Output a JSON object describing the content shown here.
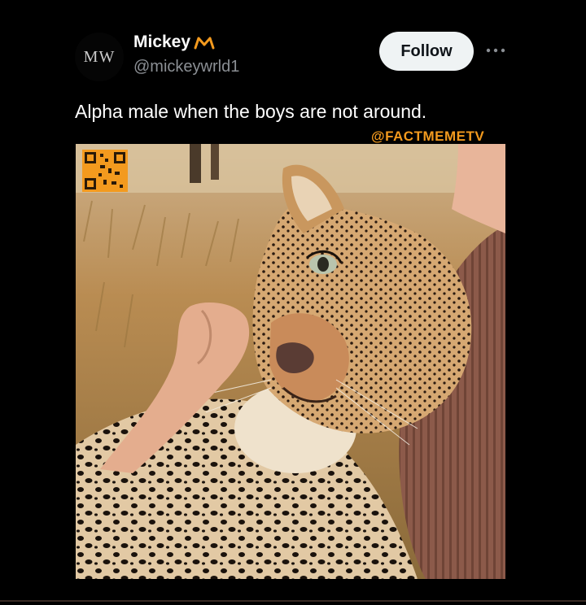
{
  "author": {
    "avatar_text": "MW",
    "display_name": "Mickey",
    "handle": "@mickeywrld1",
    "badge_icon": "crown-icon"
  },
  "actions": {
    "follow_label": "Follow",
    "more_icon": "more-icon"
  },
  "tweet": {
    "text": "Alpha male when the boys are not around."
  },
  "media": {
    "watermark": "@FACTMEMETV",
    "qr_icon": "qr-code-icon",
    "watermark_color": "#f39a1e"
  },
  "colors": {
    "background": "#000000",
    "follow_button_bg": "#eff3f4",
    "handle_gray": "#8b8f94"
  }
}
